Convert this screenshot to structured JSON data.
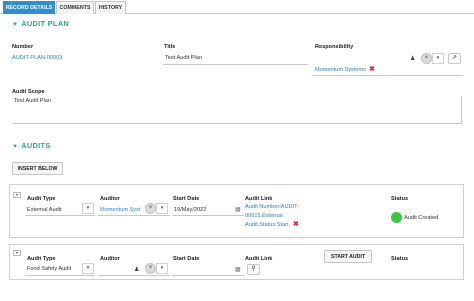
{
  "tabs": [
    {
      "label": "RECORD DETAILS"
    },
    {
      "label": "COMMENTS"
    },
    {
      "label": "HISTORY"
    }
  ],
  "audit_plan": {
    "title": "AUDIT PLAN",
    "number_label": "Number",
    "number_value": "AUDIT-PLAN-00003",
    "title_label": "Title",
    "title_value": "Test Audit Plan",
    "responsibility_label": "Responsibility",
    "responsibility_value": "Momentum Systems",
    "scope_label": "Audit Scope",
    "scope_value": "Test Audit Plan"
  },
  "audits": {
    "title": "AUDITS",
    "insert_below": "INSERT BELOW",
    "rows": [
      {
        "type_label": "Audit Type",
        "type_value": "External Audit",
        "auditor_label": "Auditor",
        "auditor_value": "Momentum Syst",
        "start_label": "Start Date",
        "start_value": "19/May/2022",
        "link_label": "Audit Link",
        "link_line1": "Audit Number:AUDIT-",
        "link_line2": "00015,External",
        "link_line3": "Audit,Status:Start,",
        "status_label": "Status",
        "status_value": "Audit Created",
        "status_color": "#3ec43e"
      },
      {
        "type_label": "Audit Type",
        "type_value": "Food Safety Audit",
        "auditor_label": "Auditor",
        "start_label": "Start Date",
        "link_label": "Audit Link",
        "start_audit": "START AUDIT",
        "status_label": "Status"
      }
    ]
  },
  "colors": {
    "accent": "#2f8fd1",
    "section": "#26a69a",
    "link": "#2a7fc1",
    "danger": "#d32f2f"
  },
  "icons": [
    "x-icon",
    "chevron-down-icon",
    "person-icon",
    "external-link-icon",
    "calendar-icon",
    "link-icon",
    "remove-icon",
    "triangle-down-icon"
  ]
}
